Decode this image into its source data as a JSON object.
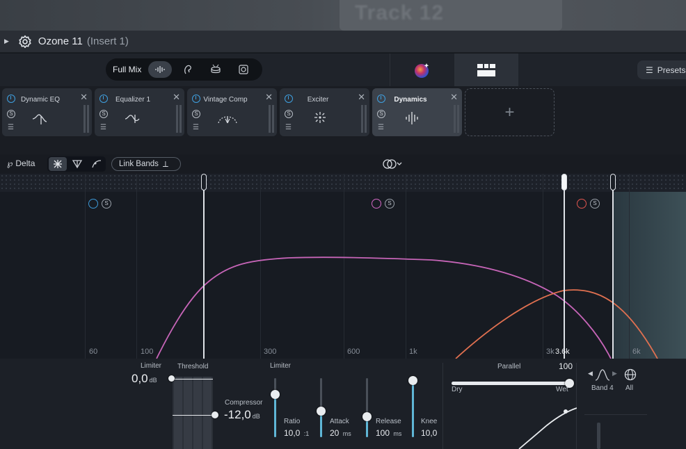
{
  "daw": {
    "track_label": "Track 12"
  },
  "plugin": {
    "name": "Ozone 11",
    "insert": "(Insert 1)"
  },
  "header": {
    "mode_label": "Full Mix",
    "modes": [
      "full-mix-icon",
      "vocal-icon",
      "drums-icon",
      "instrument-icon"
    ],
    "presets_label": "Presets"
  },
  "modules": [
    {
      "title": "Dynamic EQ",
      "icon": "dynamic-eq-icon"
    },
    {
      "title": "Equalizer 1",
      "icon": "equalizer-icon"
    },
    {
      "title": "Vintage Comp",
      "icon": "vintage-comp-icon"
    },
    {
      "title": "Exciter",
      "icon": "exciter-icon"
    },
    {
      "title": "Dynamics",
      "icon": "dynamics-icon",
      "active": true
    }
  ],
  "controls": {
    "delta_label": "Delta",
    "link_bands_label": "Link Bands"
  },
  "spectrum": {
    "freq_labels": [
      "60",
      "100",
      "300",
      "600",
      "1k",
      "3k",
      "6k"
    ],
    "crossover_readout": "3.6k",
    "band_colors": {
      "band1": "#3d9ad9",
      "band2": "#d469c5",
      "band3": "#e2564f",
      "curve_pink": "#c765b8",
      "curve_orange": "#e07050"
    }
  },
  "bottom": {
    "limiter_label": "Limiter",
    "limiter_value": "0,0",
    "limiter_unit": "dB",
    "threshold_label": "Threshold",
    "compressor_label": "Compressor",
    "compressor_value": "-12,0",
    "compressor_unit": "dB",
    "limiter_section_label": "Limiter",
    "ratio_label": "Ratio",
    "ratio_value": "10,0",
    "ratio_unit": ":1",
    "attack_label": "Attack",
    "attack_value": "20",
    "attack_unit": "ms",
    "release_label": "Release",
    "release_value": "100",
    "release_unit": "ms",
    "knee_label": "Knee",
    "knee_value": "10,0",
    "parallel_label": "Parallel",
    "parallel_value": "100",
    "parallel_fraction": 1.0,
    "dry_label": "Dry",
    "wet_label": "Wet",
    "band_label": "Band 4",
    "all_label": "All"
  }
}
